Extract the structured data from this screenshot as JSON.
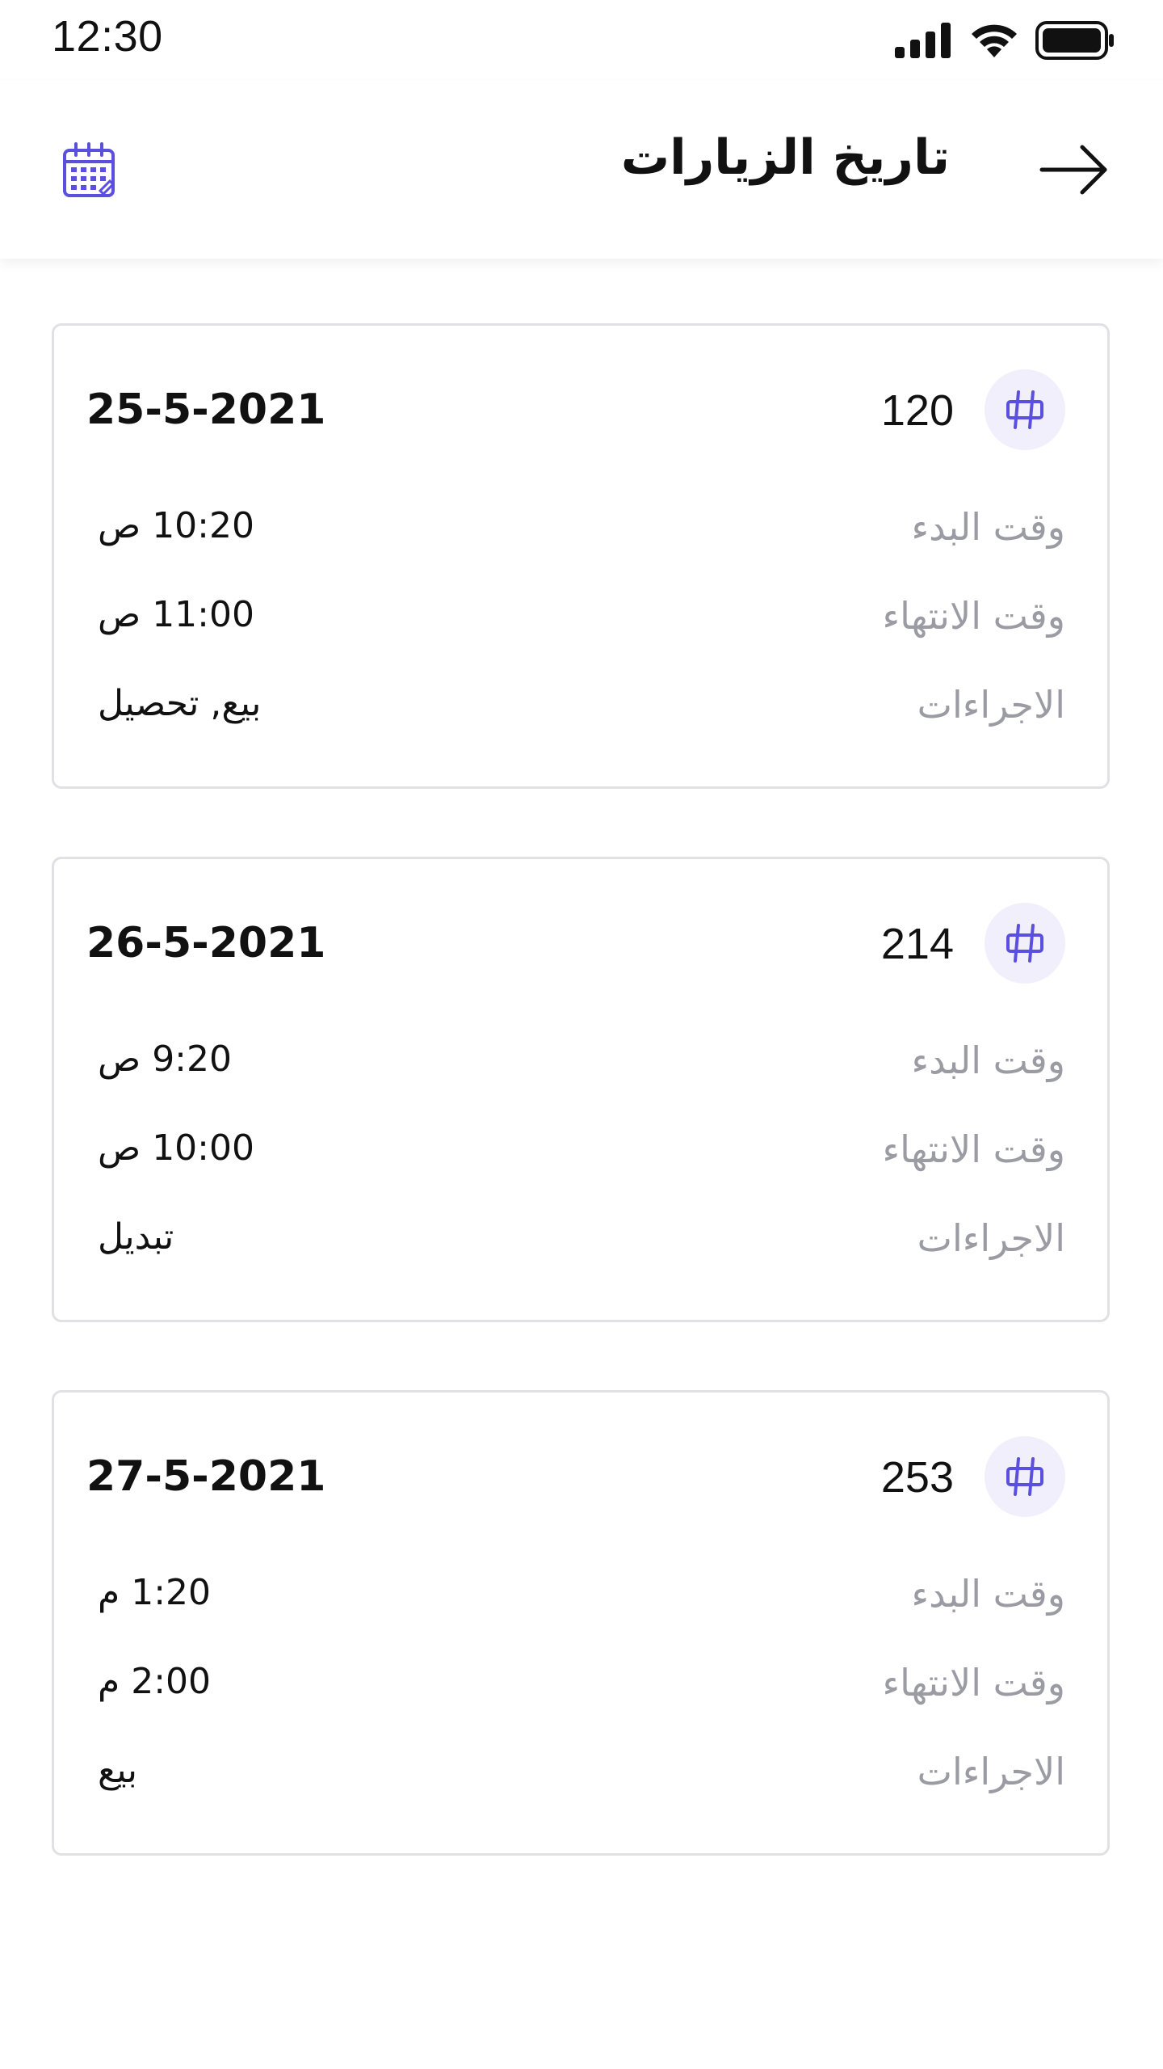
{
  "status_bar": {
    "time": "12:30"
  },
  "header": {
    "title": "تاريخ الزيارات",
    "calendar_icon": "calendar-icon",
    "back_icon": "arrow-right-icon"
  },
  "labels": {
    "start_time": "وقت البدء",
    "end_time": "وقت الانتهاء",
    "actions": "الاجراءات"
  },
  "visits": [
    {
      "number": "120",
      "date": "25-5-2021",
      "start": "10:20 ص",
      "end": "11:00 ص",
      "actions": "بيع, تحصيل"
    },
    {
      "number": "214",
      "date": "26-5-2021",
      "start": "9:20 ص",
      "end": "10:00 ص",
      "actions": "تبديل"
    },
    {
      "number": "253",
      "date": "27-5-2021",
      "start": "1:20 م",
      "end": "2:00 م",
      "actions": "بيع"
    }
  ],
  "colors": {
    "accent": "#5b4fe0",
    "badge_bg": "#f0effb",
    "label_gray": "#9b9ba3",
    "border": "#e1e1e5"
  }
}
